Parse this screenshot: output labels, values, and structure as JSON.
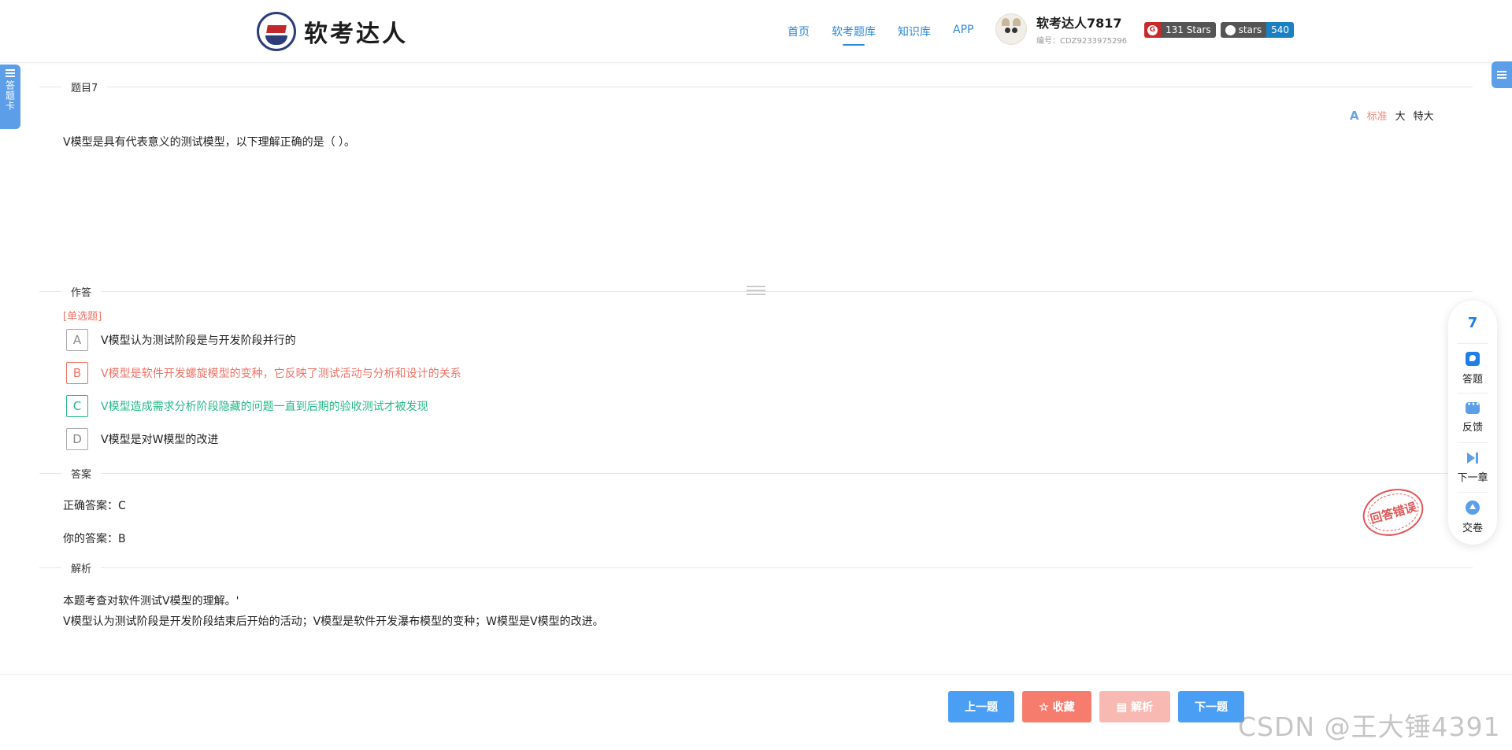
{
  "header": {
    "logo_text": "软考达人",
    "nav": [
      {
        "label": "首页"
      },
      {
        "label": "软考题库",
        "active": true
      },
      {
        "label": "知识库"
      },
      {
        "label": "APP"
      }
    ],
    "user": {
      "name": "软考达人7817",
      "id_text": "编号：CDZ9233975296"
    },
    "badges": {
      "gitee_stars": "131 Stars",
      "github_label": "stars",
      "github_count": "540"
    }
  },
  "side_tab": {
    "label": "答题卡"
  },
  "sections": {
    "question_label": "题目7",
    "answer_label": "作答",
    "key_label": "答案",
    "analysis_label": "解析"
  },
  "font_size_control": {
    "standard": "标准",
    "large": "大",
    "xlarge": "特大"
  },
  "question": {
    "text": "V模型是具有代表意义的测试模型，以下理解正确的是（ ）。",
    "type": "[单选题]",
    "options": [
      {
        "letter": "A",
        "text": "V模型认为测试阶段是与开发阶段并行的",
        "state": "normal"
      },
      {
        "letter": "B",
        "text": "V模型是软件开发螺旋模型的变种，它反映了测试活动与分析和设计的关系",
        "state": "wrong"
      },
      {
        "letter": "C",
        "text": "V模型造成需求分析阶段隐藏的问题一直到后期的验收测试才被发现",
        "state": "correct"
      },
      {
        "letter": "D",
        "text": "V模型是对W模型的改进",
        "state": "normal"
      }
    ]
  },
  "answer": {
    "correct": "正确答案：C",
    "yours": "你的答案：B",
    "stamp_text": "回答错误"
  },
  "analysis": {
    "line1": "本题考查对软件测试V模型的理解。'",
    "line2": "V模型认为测试阶段是开发阶段结束后开始的活动；V模型是软件开发瀑布模型的变种；W模型是V模型的改进。"
  },
  "float_bar": {
    "number": "7",
    "answer": "答题",
    "feedback": "反馈",
    "next_chapter": "下一章",
    "submit": "交卷"
  },
  "footer": {
    "prev": "上一题",
    "favorite": "收藏",
    "analysis": "解析",
    "next": "下一题"
  },
  "watermark": "CSDN @王大锤4391",
  "colors": {
    "primary": "#4a9ff5",
    "wrong": "#f07265",
    "correct": "#27b98a"
  }
}
